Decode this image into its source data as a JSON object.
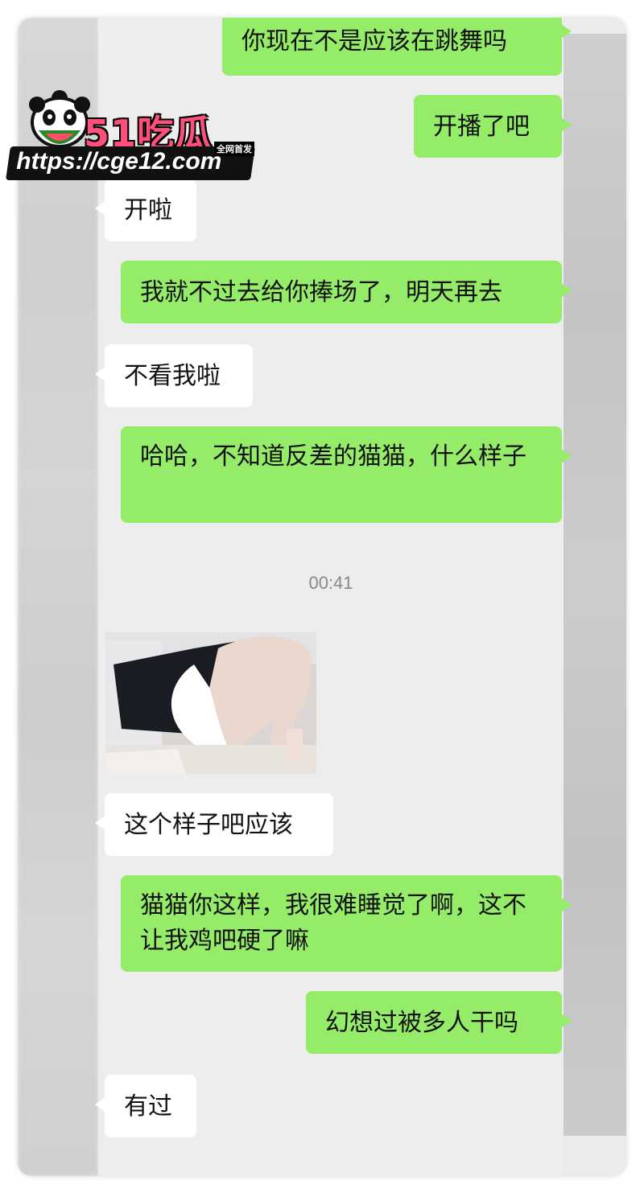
{
  "messages": [
    {
      "side": "sent",
      "text": "你现在不是应该在跳舞吗"
    },
    {
      "side": "sent",
      "text": "开播了吧"
    },
    {
      "side": "recv",
      "text": "开啦"
    },
    {
      "side": "sent",
      "text": "我就不过去给你捧场了，明天再去"
    },
    {
      "side": "recv",
      "text": "不看我啦"
    },
    {
      "side": "sent",
      "text": "哈哈，不知道反差的猫猫，什么样子"
    },
    {
      "side": "recv",
      "text": "这个样子吧应该"
    },
    {
      "side": "sent",
      "text": "猫猫你这样，我很难睡觉了啊，这不让我鸡吧硬了嘛"
    },
    {
      "side": "sent",
      "text": "幻想过被多人干吗"
    },
    {
      "side": "recv",
      "text": "有过"
    }
  ],
  "timestamp": "00:41",
  "watermark": {
    "brand": "51吃瓜",
    "tag": "全网首发",
    "url": "https://cge12.com"
  },
  "colors": {
    "sent_bubble": "#95ec69",
    "recv_bubble": "#ffffff",
    "chat_background": "#ededed"
  }
}
